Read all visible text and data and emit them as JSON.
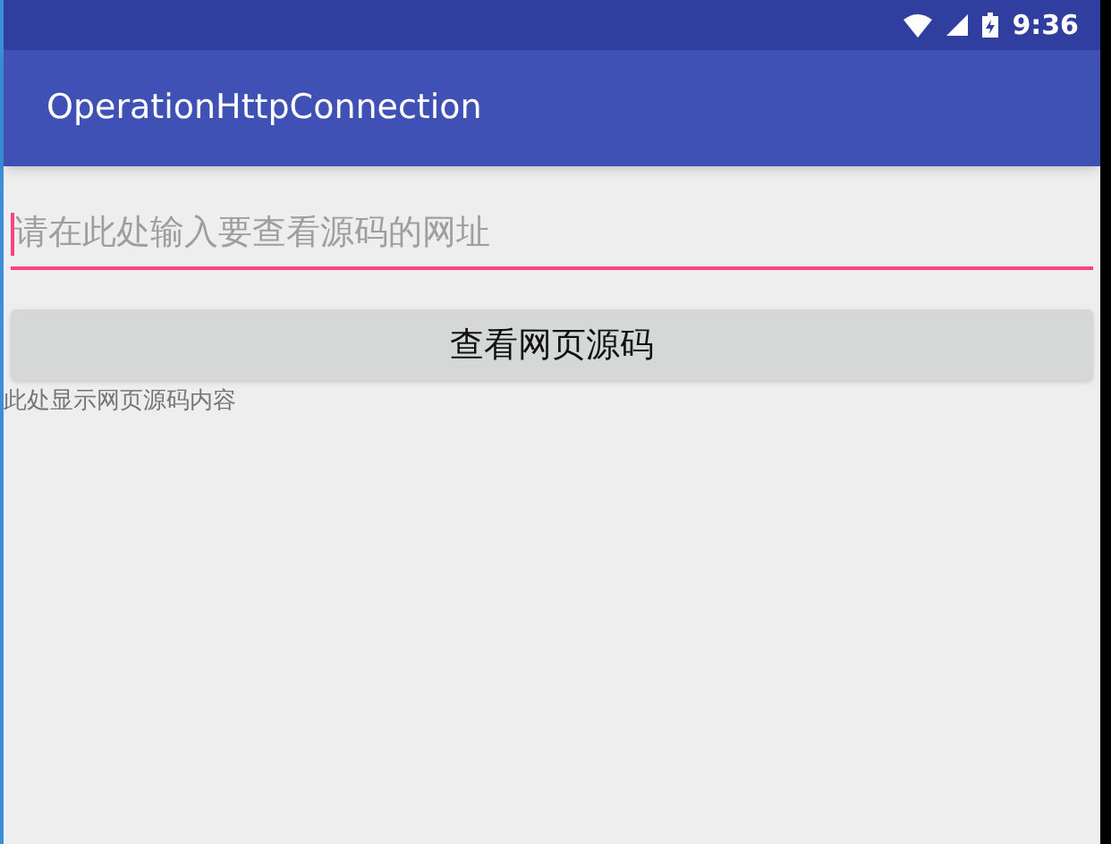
{
  "status_bar": {
    "time": "9:36"
  },
  "app_bar": {
    "title": "OperationHttpConnection"
  },
  "url_field": {
    "placeholder": "请在此处输入要查看源码的网址",
    "focused": true
  },
  "button": {
    "label": "查看网页源码"
  },
  "result_text": "此处显示网页源码内容"
}
